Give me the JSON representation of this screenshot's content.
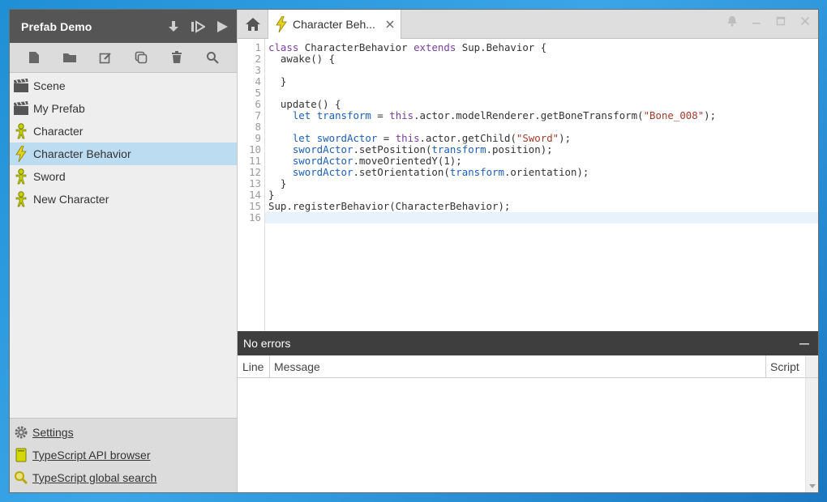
{
  "project": {
    "title": "Prefab Demo"
  },
  "tree": {
    "items": [
      {
        "label": "Scene",
        "icon": "clapperboard-icon",
        "selected": false
      },
      {
        "label": "My Prefab",
        "icon": "clapperboard-icon",
        "selected": false
      },
      {
        "label": "Character",
        "icon": "character-icon",
        "selected": false
      },
      {
        "label": "Character Behavior",
        "icon": "lightning-icon",
        "selected": true
      },
      {
        "label": "Sword",
        "icon": "character-icon",
        "selected": false
      },
      {
        "label": "New Character",
        "icon": "character-icon",
        "selected": false
      }
    ]
  },
  "footer": {
    "settings": "Settings",
    "api_browser": "TypeScript API browser",
    "global_search": "TypeScript global search"
  },
  "tab": {
    "label": "Character Beh..."
  },
  "editor": {
    "line_numbers": [
      "1",
      "2",
      "3",
      "4",
      "5",
      "6",
      "7",
      "8",
      "9",
      "10",
      "11",
      "12",
      "13",
      "14",
      "15",
      "16"
    ]
  },
  "errors": {
    "title": "No errors",
    "columns": {
      "line": "Line",
      "message": "Message",
      "script": "Script"
    }
  },
  "colors": {
    "accent_selected": "#bcdcf2",
    "header_dark": "#555555",
    "icon_yellow": "#e4d21e",
    "icon_green": "#c8d200"
  }
}
